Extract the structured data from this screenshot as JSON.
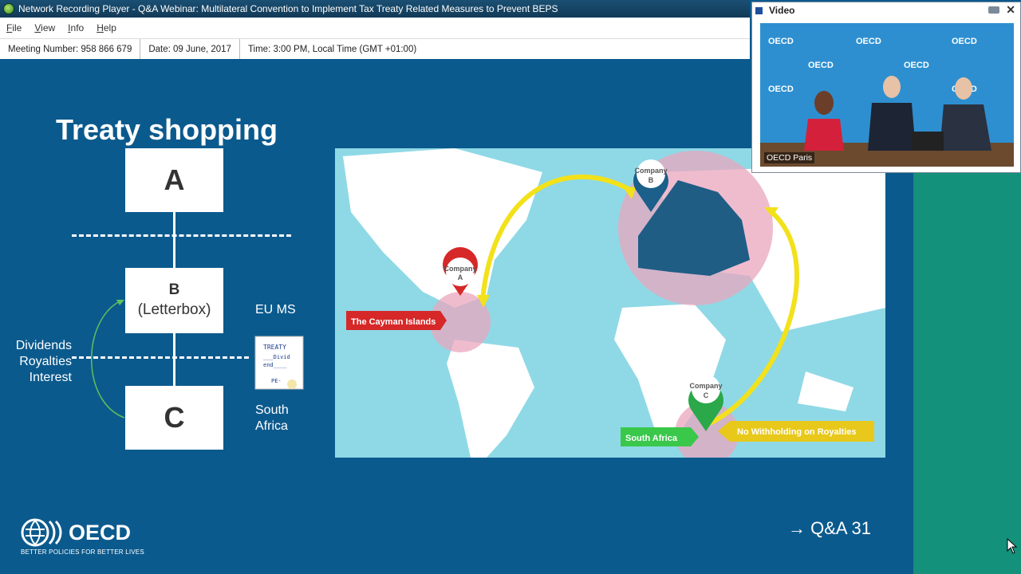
{
  "window": {
    "title": "Network Recording Player - Q&A Webinar: Multilateral Convention to Implement Tax Treaty Related Measures to Prevent BEPS"
  },
  "menu": [
    "File",
    "View",
    "Info",
    "Help"
  ],
  "info_bar": {
    "meeting": "Meeting Number: 958 866 679",
    "date": "Date: 09 June, 2017",
    "time": "Time: 3:00 PM, Local Time (GMT +01:00)"
  },
  "slide": {
    "title": "Treaty shopping",
    "box_a": "A",
    "box_b_label": "B",
    "box_b_sub": "(Letterbox)",
    "box_c": "C",
    "flow_labels": [
      "Dividends",
      "Royalties",
      "Interest"
    ],
    "eu_ms": "EU MS",
    "south_africa": "South Africa",
    "treaty_doc": {
      "line1": "TREATY",
      "line2": "___Divid",
      "line3": "end____",
      "line4": "PE-"
    },
    "map": {
      "company_a": [
        "Company",
        "A"
      ],
      "company_b": [
        "Company",
        "B"
      ],
      "company_c": [
        "Company",
        "C"
      ],
      "cayman": "The Cayman Islands",
      "south_africa": "South Africa",
      "no_withholding": "No Withholding on Royalties"
    },
    "logo_word": "OECD",
    "logo_tag": "BETTER POLICIES FOR BETTER LIVES",
    "qa": "Q&A 31"
  },
  "video": {
    "title": "Video",
    "caption": "OECD Paris",
    "backdrop_word": "OECD"
  },
  "colors": {
    "slide_bg": "#0b5a8d",
    "teal": "#14917a",
    "pin_red": "#d62828",
    "pin_blue": "#1b5f8a",
    "pin_green": "#2aa84a",
    "arrow_yellow": "#f2e11b"
  }
}
